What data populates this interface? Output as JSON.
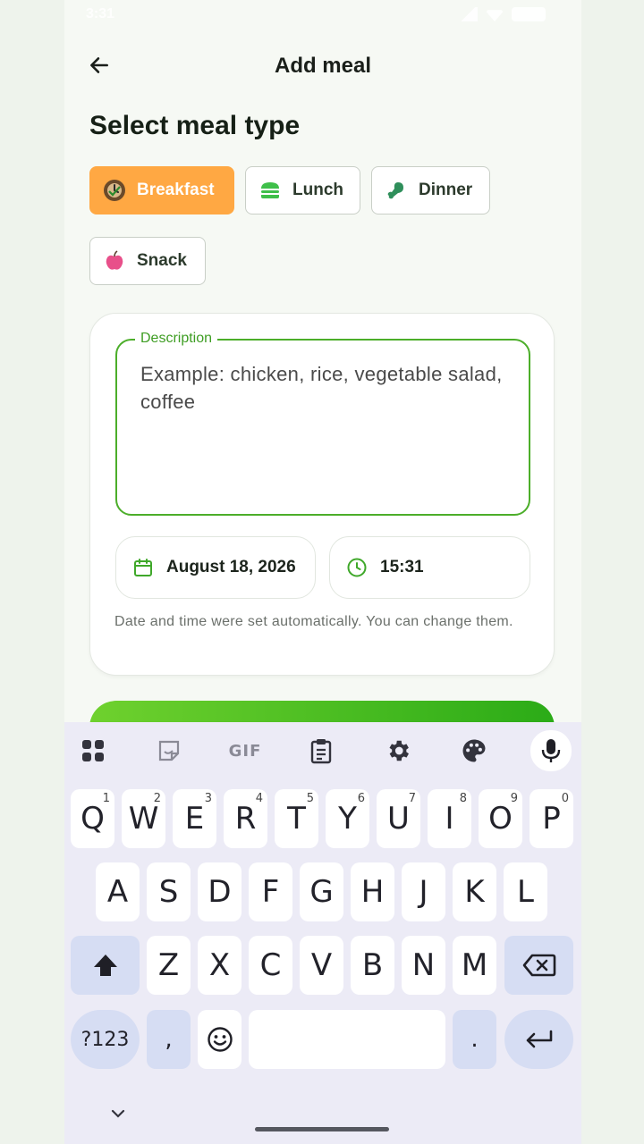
{
  "status_bar": {
    "time": "3:31"
  },
  "header": {
    "title": "Add meal"
  },
  "meal_type": {
    "heading": "Select meal type",
    "options": [
      {
        "label": "Breakfast",
        "icon": "clock-plate-icon",
        "selected": true
      },
      {
        "label": "Lunch",
        "icon": "burger-icon",
        "selected": false
      },
      {
        "label": "Dinner",
        "icon": "drumstick-icon",
        "selected": false
      },
      {
        "label": "Snack",
        "icon": "apple-icon",
        "selected": false
      }
    ]
  },
  "form": {
    "description_label": "Description",
    "description_placeholder": "Example: chicken, rice, vegetable salad, coffee",
    "date": "August 18, 2026",
    "time": "15:31",
    "hint": "Date and time were set automatically. You can change them."
  },
  "keyboard": {
    "toolbar": [
      "apps-icon",
      "sticker-icon",
      "GIF",
      "clipboard-icon",
      "gear-icon",
      "palette-icon",
      "mic-icon"
    ],
    "row1": [
      "Q",
      "W",
      "E",
      "R",
      "T",
      "Y",
      "U",
      "I",
      "O",
      "P"
    ],
    "row1_nums": [
      "1",
      "2",
      "3",
      "4",
      "5",
      "6",
      "7",
      "8",
      "9",
      "0"
    ],
    "row2": [
      "A",
      "S",
      "D",
      "F",
      "G",
      "H",
      "J",
      "K",
      "L"
    ],
    "row3": [
      "Z",
      "X",
      "C",
      "V",
      "B",
      "N",
      "M"
    ],
    "symbols_label": "?123",
    "comma": ",",
    "period": "."
  },
  "colors": {
    "accent_green": "#4cae2a",
    "selected_chip": "#ffa843"
  }
}
